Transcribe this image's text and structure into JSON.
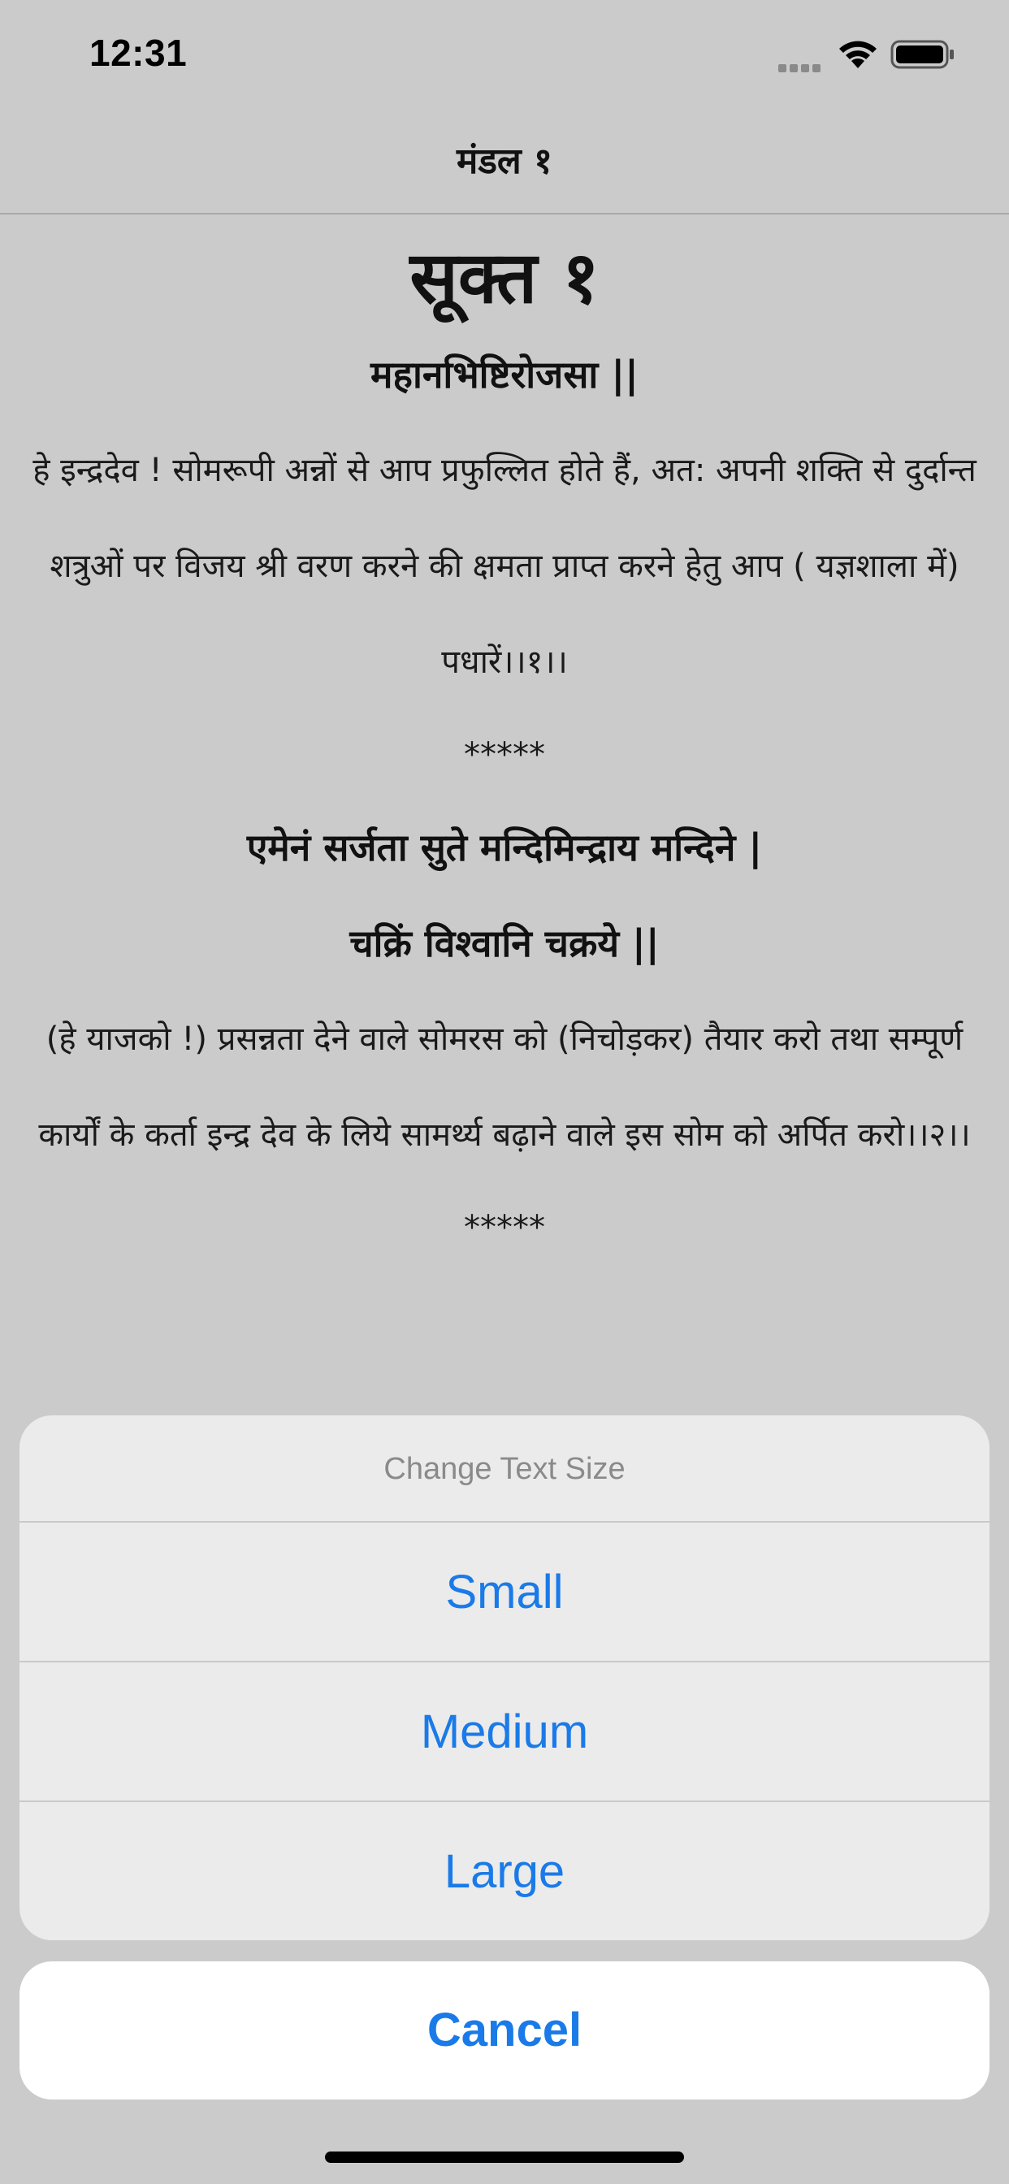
{
  "status_bar": {
    "time": "12:31",
    "icons": [
      "signal-icon",
      "wifi-icon",
      "battery-icon"
    ]
  },
  "nav": {
    "title": "मंडल १"
  },
  "content": {
    "heading": "सूक्त १",
    "verse1": {
      "lines": [
        "महानभिष्टिरोजसा ||"
      ],
      "translation": "हे इन्द्रदेव ! सोमरूपी अन्नों से आप प्रफुल्लित होते हैं, अत: अपनी शक्ति से दुर्दान्त शत्रुओं पर विजय श्री वरण करने की क्षमता प्राप्त करने हेतु आप ( यज्ञशाला में) पधारें।।१।।",
      "separator": "*****"
    },
    "verse2": {
      "lines": [
        "एमेनं सर्जता सुते मन्दिमिन्द्राय मन्दिने |",
        "चक्रिं विश्वानि चक्रये ||"
      ],
      "translation": "(हे याजको !) प्रसन्नता देने वाले सोमरस को (निचोड़कर) तैयार करो तथा सम्पूर्ण कार्यों के कर्ता इन्द्र देव के लिये सामर्थ्य बढ़ाने वाले इस सोम को अर्पित करो।।२।।",
      "separator": "*****"
    }
  },
  "action_sheet": {
    "title": "Change Text Size",
    "options": [
      "Small",
      "Medium",
      "Large"
    ],
    "cancel": "Cancel"
  },
  "colors": {
    "accent": "#1a7ae8",
    "dimmed_background": "#cbcbcb",
    "sheet_background": "#ebebeb"
  }
}
